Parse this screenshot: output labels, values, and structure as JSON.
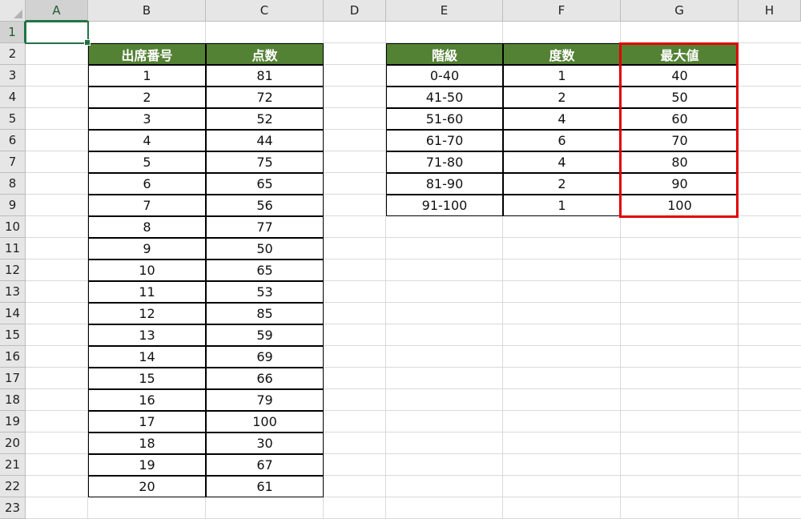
{
  "columns": [
    "A",
    "B",
    "C",
    "D",
    "E",
    "F",
    "G",
    "H"
  ],
  "rows": [
    "1",
    "2",
    "3",
    "4",
    "5",
    "6",
    "7",
    "8",
    "9",
    "10",
    "11",
    "12",
    "13",
    "14",
    "15",
    "16",
    "17",
    "18",
    "19",
    "20",
    "21",
    "22",
    "23"
  ],
  "selected_cell": {
    "column": "A",
    "row": "1"
  },
  "table_scores": {
    "headers": [
      "出席番号",
      "点数"
    ],
    "rows": [
      [
        "1",
        "81"
      ],
      [
        "2",
        "72"
      ],
      [
        "3",
        "52"
      ],
      [
        "4",
        "44"
      ],
      [
        "5",
        "75"
      ],
      [
        "6",
        "65"
      ],
      [
        "7",
        "56"
      ],
      [
        "8",
        "77"
      ],
      [
        "9",
        "50"
      ],
      [
        "10",
        "65"
      ],
      [
        "11",
        "53"
      ],
      [
        "12",
        "85"
      ],
      [
        "13",
        "59"
      ],
      [
        "14",
        "69"
      ],
      [
        "15",
        "66"
      ],
      [
        "16",
        "79"
      ],
      [
        "17",
        "100"
      ],
      [
        "18",
        "30"
      ],
      [
        "19",
        "67"
      ],
      [
        "20",
        "61"
      ]
    ]
  },
  "table_frequency": {
    "headers": [
      "階級",
      "度数",
      "最大値"
    ],
    "rows": [
      [
        "0-40",
        "1",
        "40"
      ],
      [
        "41-50",
        "2",
        "50"
      ],
      [
        "51-60",
        "4",
        "60"
      ],
      [
        "61-70",
        "6",
        "70"
      ],
      [
        "71-80",
        "4",
        "80"
      ],
      [
        "81-90",
        "2",
        "90"
      ],
      [
        "91-100",
        "1",
        "100"
      ]
    ]
  },
  "colors": {
    "header_fill": "#548235",
    "highlight_border": "#e00000",
    "selection": "#217346"
  }
}
